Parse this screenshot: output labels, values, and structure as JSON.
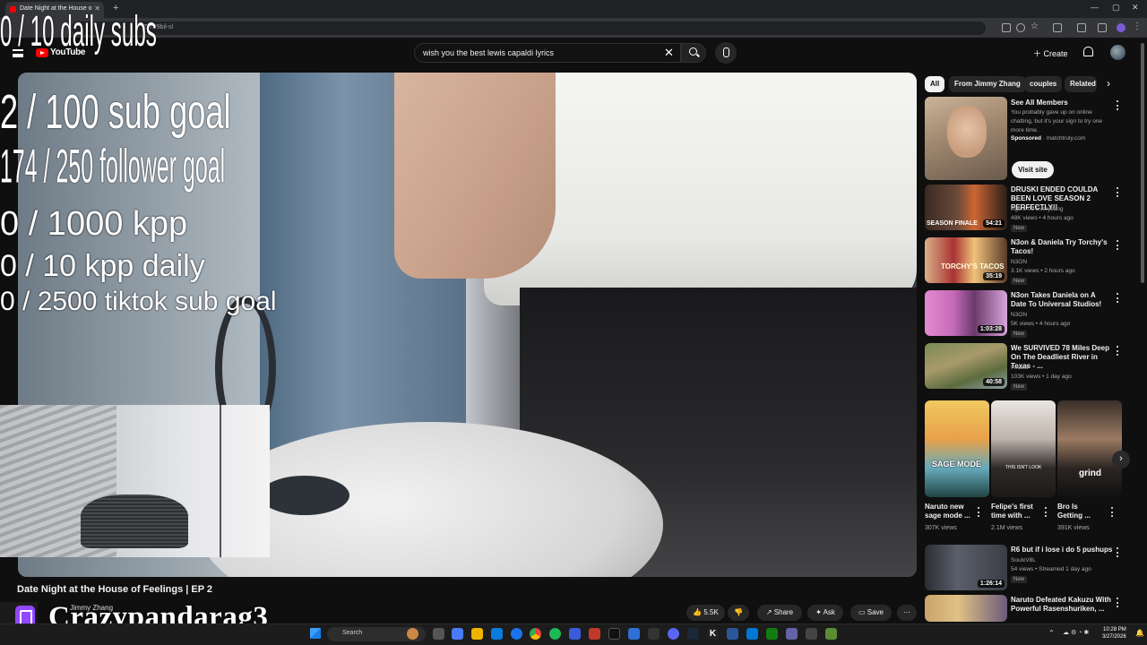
{
  "browser": {
    "tab_title": "Date Night at the House o",
    "url": "ZiTP9bil-sl"
  },
  "youtube": {
    "logo_text": "YouTube",
    "search_value": "wish you the best lewis capaldi lyrics",
    "create_label": "Create"
  },
  "overlay": {
    "daily_subs": "0 / 10 daily subs",
    "sub_goal": "2  / 100 sub goal",
    "follower_goal": "174 / 250 follower goal",
    "kpp": "0 / 1000 kpp",
    "kpp_daily": "0 / 10 kpp daily",
    "tiktok_goal": "0 / 2500 tiktok sub goal",
    "streamer_name": "Crazypandarag3"
  },
  "video": {
    "title": "Date Night at the House of Feelings | EP 2",
    "channel": "Jimmy Zhang",
    "likes": "5.5K",
    "share": "Share",
    "ask": "Ask",
    "save": "Save"
  },
  "chips": [
    "All",
    "From Jimmy Zhang",
    "couples",
    "Related"
  ],
  "ad": {
    "title": "See All Members",
    "desc": "You probably gave up on online chatting, but it's your sign to try one more time.",
    "sponsored": "Sponsored",
    "domain": "matchtruly.com",
    "cta": "Visit site"
  },
  "recs": [
    {
      "title": "DRUSKI ENDED COULDA BEEN LOVE SEASON 2 PERFECTLY!!",
      "channel": "Agent 00 Everything",
      "meta": "48K views • 4 hours ago",
      "badge": "New",
      "duration": "54:21",
      "thumb_text": "SEASON FINALE"
    },
    {
      "title": "N3on & Daniela Try Torchy's Tacos!",
      "channel": "N3ON",
      "meta": "3.1K views • 2 hours ago",
      "badge": "New",
      "duration": "35:19",
      "thumb_text": "TORCHY'S TACOS"
    },
    {
      "title": "N3on Takes Daniela on A Date To Universal Studios!",
      "channel": "N3ON",
      "meta": "5K views • 4 hours ago",
      "badge": "New",
      "duration": "1:03:28",
      "thumb_text": ""
    },
    {
      "title": "We SURVIVED 78 Miles Deep On The Deadliest River in Texas - ...",
      "channel": "Finatic",
      "meta": "103K views • 1 day ago",
      "badge": "New",
      "duration": "40:58",
      "thumb_text": ""
    }
  ],
  "shorts": [
    {
      "title": "Naruto new sage mode ...",
      "views": "307K views",
      "thumb_text": "SAGE MODE"
    },
    {
      "title": "Felipe's first time with ...",
      "views": "2.1M views",
      "thumb_text": "THIS ISN'T LOOK"
    },
    {
      "title": "Bro Is Getting ...",
      "views": "391K views",
      "thumb_text": "grind"
    }
  ],
  "recs2": [
    {
      "title": "R6 but if i lose i do 5 pushups",
      "channel": "SoulxV8L",
      "meta": "54 views • Streamed 1 day ago",
      "badge": "New",
      "duration": "1:26:14"
    },
    {
      "title": "Naruto Defeated Kakuzu With Powerful Rasenshuriken, ...",
      "channel": "",
      "meta": "",
      "badge": "",
      "duration": ""
    }
  ],
  "taskbar": {
    "search": "Search",
    "time": "10:28 PM",
    "date": "3/27/2026"
  }
}
